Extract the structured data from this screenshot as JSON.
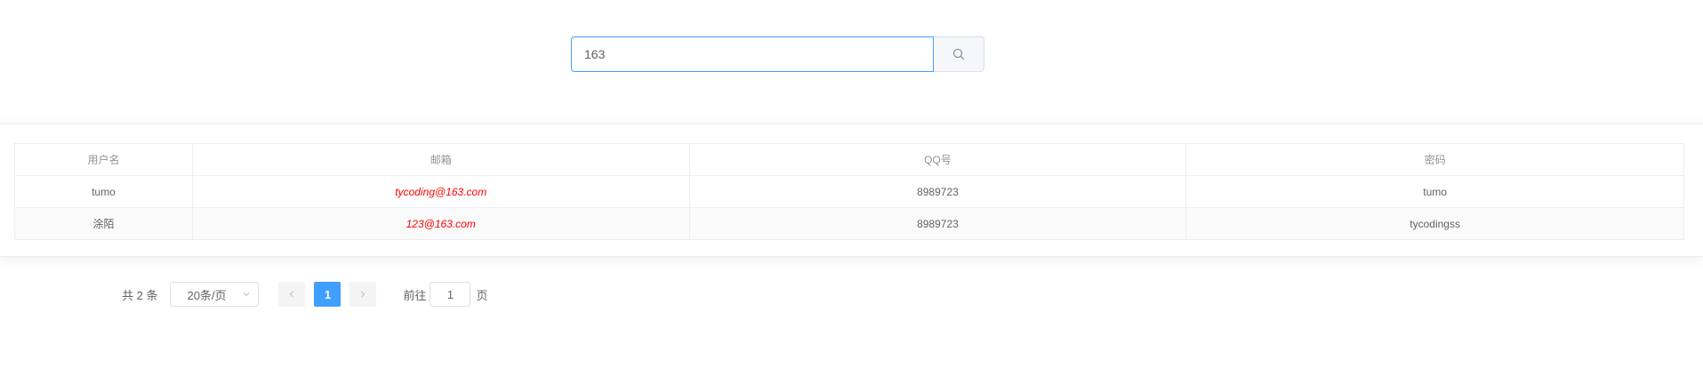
{
  "search": {
    "value": "163",
    "icon": "search-icon"
  },
  "table": {
    "headers": [
      "用户名",
      "邮箱",
      "QQ号",
      "密码"
    ],
    "rows": [
      {
        "username": "tumo",
        "email": "tycoding@163.com",
        "qq": "8989723",
        "password": "tumo"
      },
      {
        "username": "涂陌",
        "email": "123@163.com",
        "qq": "8989723",
        "password": "tycodingss"
      }
    ]
  },
  "pagination": {
    "total_text": "共 2 条",
    "page_size": "20条/页",
    "current_page": "1",
    "goto_prefix": "前往",
    "goto_value": "1",
    "goto_suffix": "页"
  },
  "colors": {
    "accent": "#409eff",
    "email_text": "#ff0000"
  }
}
